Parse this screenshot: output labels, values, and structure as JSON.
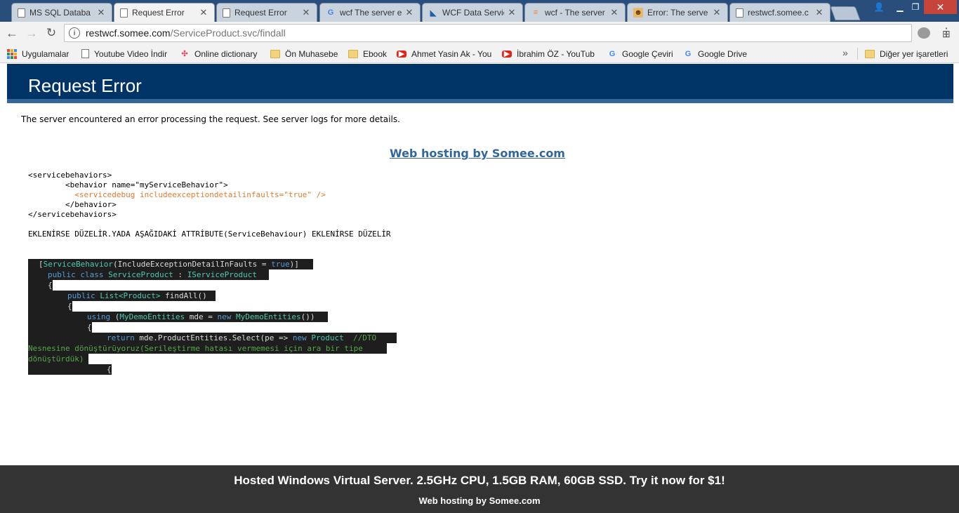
{
  "tabs": [
    {
      "title": "MS SQL Databa",
      "icon": "doc-icon"
    },
    {
      "title": "Request Error",
      "icon": "doc-icon",
      "active": true
    },
    {
      "title": "Request Error",
      "icon": "doc-icon"
    },
    {
      "title": "wcf The server e",
      "icon": "google-icon"
    },
    {
      "title": "WCF Data Servic",
      "icon": "wcf-icon"
    },
    {
      "title": "wcf - The server",
      "icon": "stackoverflow-icon"
    },
    {
      "title": "Error: The serve",
      "icon": "error-icon"
    },
    {
      "title": "restwcf.somee.c",
      "icon": "doc-icon"
    }
  ],
  "address": {
    "host": "restwcf.somee.com",
    "path": "/ServiceProduct.svc/findall"
  },
  "bookmarks": [
    {
      "label": "Uygulamalar",
      "icon": "apps-icon"
    },
    {
      "label": "Youtube Video İndir",
      "icon": "doc-icon"
    },
    {
      "label": "Online dictionary",
      "icon": "pinwheel-icon"
    },
    {
      "label": "Ön Muhasebe",
      "icon": "folder-icon"
    },
    {
      "label": "Ebook",
      "icon": "folder-icon"
    },
    {
      "label": "Ahmet Yasin Ak - You",
      "icon": "youtube-icon"
    },
    {
      "label": "İbrahim ÖZ - YouTub",
      "icon": "youtube-icon"
    },
    {
      "label": "Google Çeviri",
      "icon": "google-translate-icon"
    },
    {
      "label": "Google Drive",
      "icon": "google-icon"
    },
    {
      "label": "Diğer yer işaretleri",
      "icon": "folder-icon"
    }
  ],
  "page": {
    "heading": "Request Error",
    "intro": "The server encountered an error processing the request. See server logs for more details.",
    "promo_link": "Web hosting by Somee.com",
    "config": {
      "l1": "<servicebehaviors>",
      "l2": "        <behavior name=\"myServiceBehavior\">",
      "l3": "          <servicedebug includeexceptiondetailinfaults=\"true\" />",
      "l4": "        </behavior>",
      "l5": "</servicebehaviors>"
    },
    "note": "EKLENİRSE DÜZELİR.YADA AŞAĞIDAKİ ATTRİBUTE(ServiceBehaviour) EKLENİRSE DÜZELİR",
    "code": {
      "c1a": "[",
      "c1b": "ServiceBehavior",
      "c1c": "(IncludeExceptionDetailInFaults = ",
      "c1d": "true",
      "c1e": ")]",
      "c2a": "public class ",
      "c2b": "ServiceProduct",
      "c2c": " : ",
      "c2d": "IServiceProduct",
      "c3": "{",
      "c4a": "public ",
      "c4b": "List<",
      "c4c": "Product",
      "c4d": "> ",
      "c4e": "findAll()",
      "c5": "{",
      "c6a": "using ",
      "c6b": "(",
      "c6c": "MyDemoEntities",
      "c6d": " mde = ",
      "c6e": "new ",
      "c6f": "MyDemoEntities",
      "c6g": "())",
      "c7": "{",
      "c8a": "return ",
      "c8b": "mde.ProductEntities.Select(pe => ",
      "c8c": "new ",
      "c8d": "Product  ",
      "c8e": "//DTO ",
      "c9": "Nesnesine dönüştürüyoruz(Serileştirme hatası vermemesi için ara bir tipe ",
      "c10": "dönüştürdük)",
      "c11": "{"
    }
  },
  "footer": {
    "offer": "Hosted Windows Virtual Server. 2.5GHz CPU, 1.5GB RAM, 60GB SSD. Try it now for $1!",
    "credit": "Web hosting by Somee.com"
  }
}
